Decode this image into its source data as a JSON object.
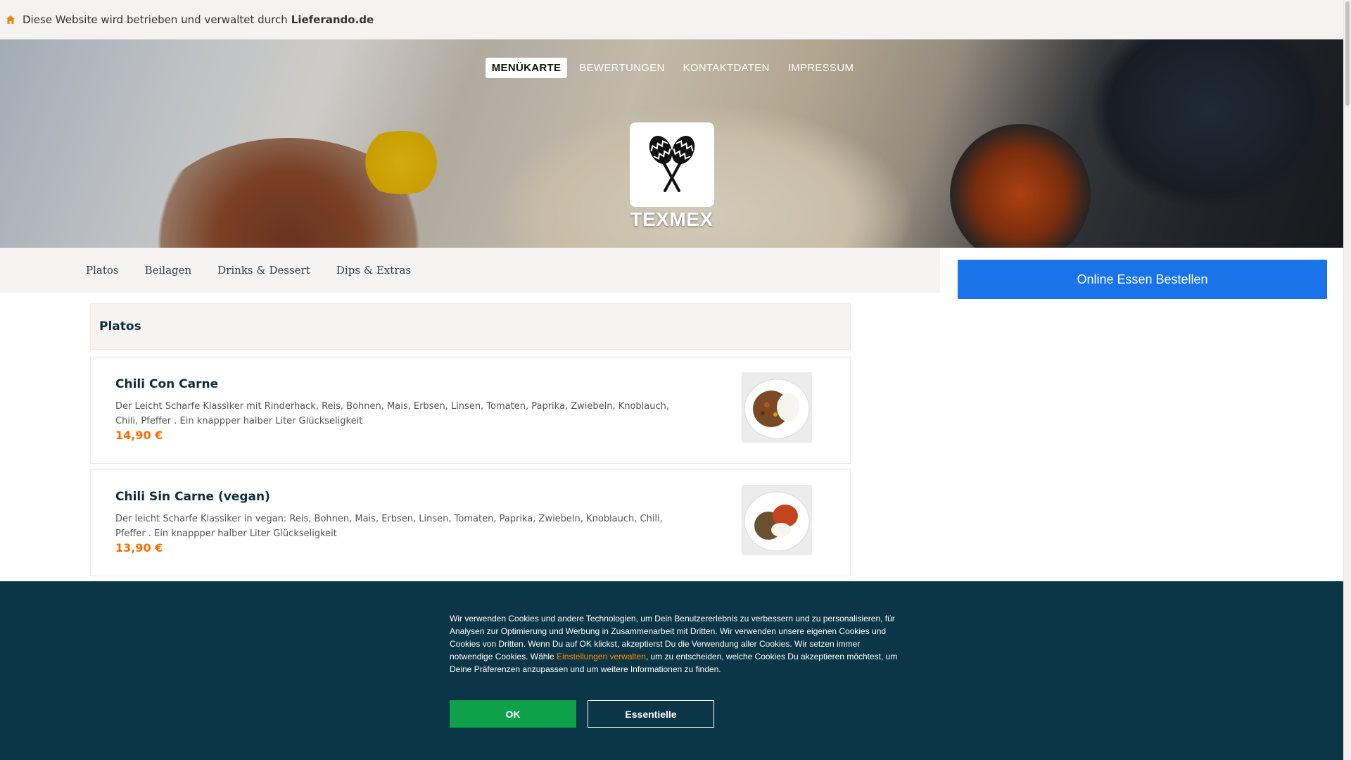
{
  "topbar": {
    "text": "Diese Website wird betrieben und verwaltet durch",
    "link": "Lieferando.de"
  },
  "header": {
    "nav": [
      {
        "label": "MENÜKARTE",
        "active": true
      },
      {
        "label": "BEWERTUNGEN",
        "active": false
      },
      {
        "label": "KONTAKTDATEN",
        "active": false
      },
      {
        "label": "IMPRESSUM",
        "active": false
      }
    ],
    "restaurant_name": "TEXMEX",
    "logo_icon": "maracas-icon"
  },
  "categories": [
    "Platos",
    "Beilagen",
    "Drinks & Dessert",
    "Dips & Extras"
  ],
  "order_button": "Online Essen Bestellen",
  "section": {
    "title": "Platos",
    "dishes": [
      {
        "name": "Chili Con Carne",
        "description": "Der Leicht Scharfe Klassiker mit Rinderhack, Reis, Bohnen, Mais, Erbsen, Linsen, Tomaten, Paprika, Zwiebeln, Knoblauch, Chili, Pfeffer . Ein knappper halber Liter Glückseligkeit",
        "price": "14,90 €"
      },
      {
        "name": "Chili Sin Carne (vegan)",
        "description": "Der leicht Scharfe Klassiker in vegan: Reis, Bohnen, Mais, Erbsen, Linsen, Tomaten, Paprika, Zwiebeln, Knoblauch, Chili, Pfeffer . Ein knappper halber Liter Glückseligkeit",
        "price": "13,90 €"
      }
    ]
  },
  "cookie_banner": {
    "text_before_link": "Wir verwenden Cookies und andere Technologien, um Dein Benutzererlebnis zu verbessern und zu personalisieren, für Analysen zur Optimierung und Werbung in Zusammenarbeit mit Dritten. Wir verwenden unsere eigenen Cookies und Cookies von Dritten. Wenn Du auf OK klickst, akzeptierst Du die Verwendung aller Cookies. Wir setzen immer notwendige Cookies. Wähle ",
    "link": "Einstellungen verwalten",
    "text_after_link": ", um zu entscheiden, welche Cookies Du akzeptieren möchtest, um Deine Präferenzen anzupassen und um weitere Informationen zu finden.",
    "ok_label": "OK",
    "essential_label": "Essentielle"
  },
  "colors": {
    "order_button": "#1a73e8",
    "price": "#ff6a00",
    "cookie_bg": "#0b3648",
    "ok_button": "#0fa04a",
    "link": "#ff8a00"
  }
}
